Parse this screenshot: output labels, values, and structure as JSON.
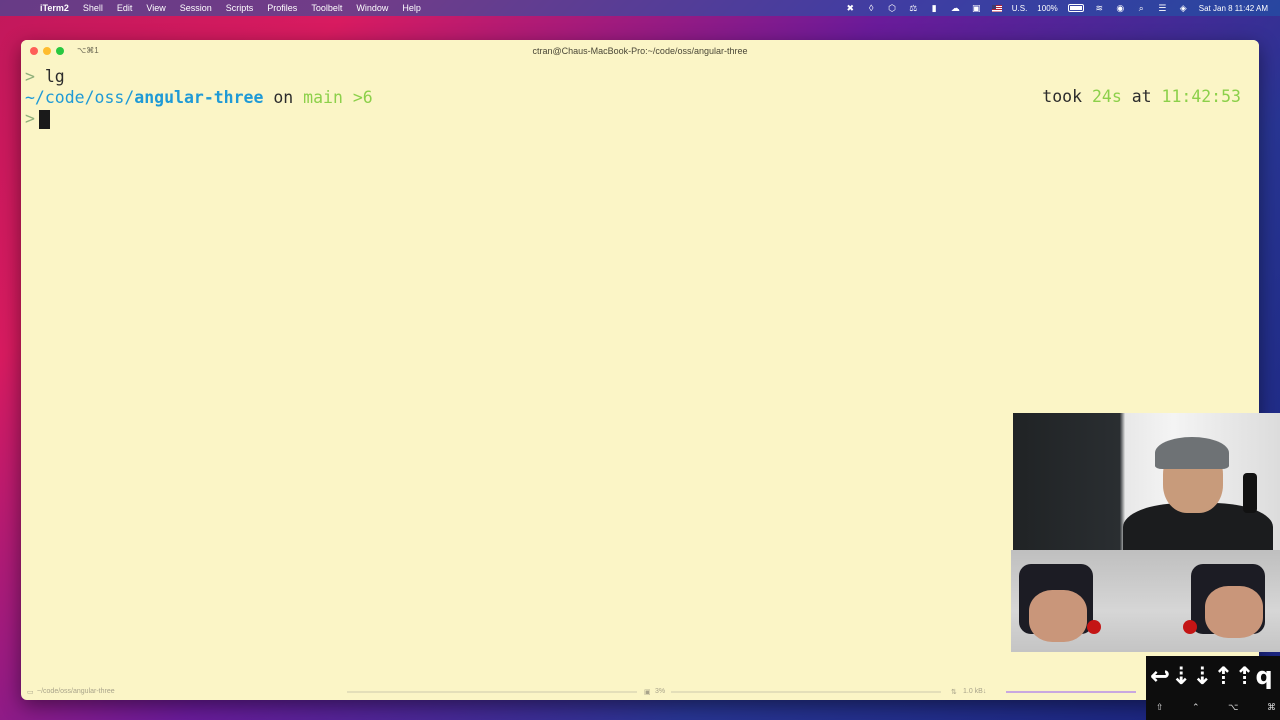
{
  "menubar": {
    "app_name": "iTerm2",
    "items": [
      "Shell",
      "Edit",
      "View",
      "Session",
      "Scripts",
      "Profiles",
      "Toolbelt",
      "Window",
      "Help"
    ],
    "input_source": "U.S.",
    "battery": "100%",
    "datetime": "Sat Jan 8  11:42 AM"
  },
  "window": {
    "tab_shortcut": "⌥⌘1",
    "title": "ctran@Chaus-MacBook-Pro:~/code/oss/angular-three"
  },
  "terminal": {
    "prompt_symbol": ">",
    "last_command": "lg",
    "path_prefix": "~/code/oss/",
    "path_repo": "angular-three",
    "on_word": "on",
    "branch": "main",
    "ahead": ">6",
    "took_word": "took",
    "duration": "24s",
    "at_word": "at",
    "time": "11:42:53"
  },
  "statusbar": {
    "path": "~/code/oss/angular-three",
    "cpu": "3%",
    "network": "1.0 kB↓"
  },
  "key_overlay": {
    "keys": "↩⇣⇣⇡⇡q",
    "mods": [
      "⇧",
      "⌃",
      "⌥",
      "⌘"
    ]
  }
}
